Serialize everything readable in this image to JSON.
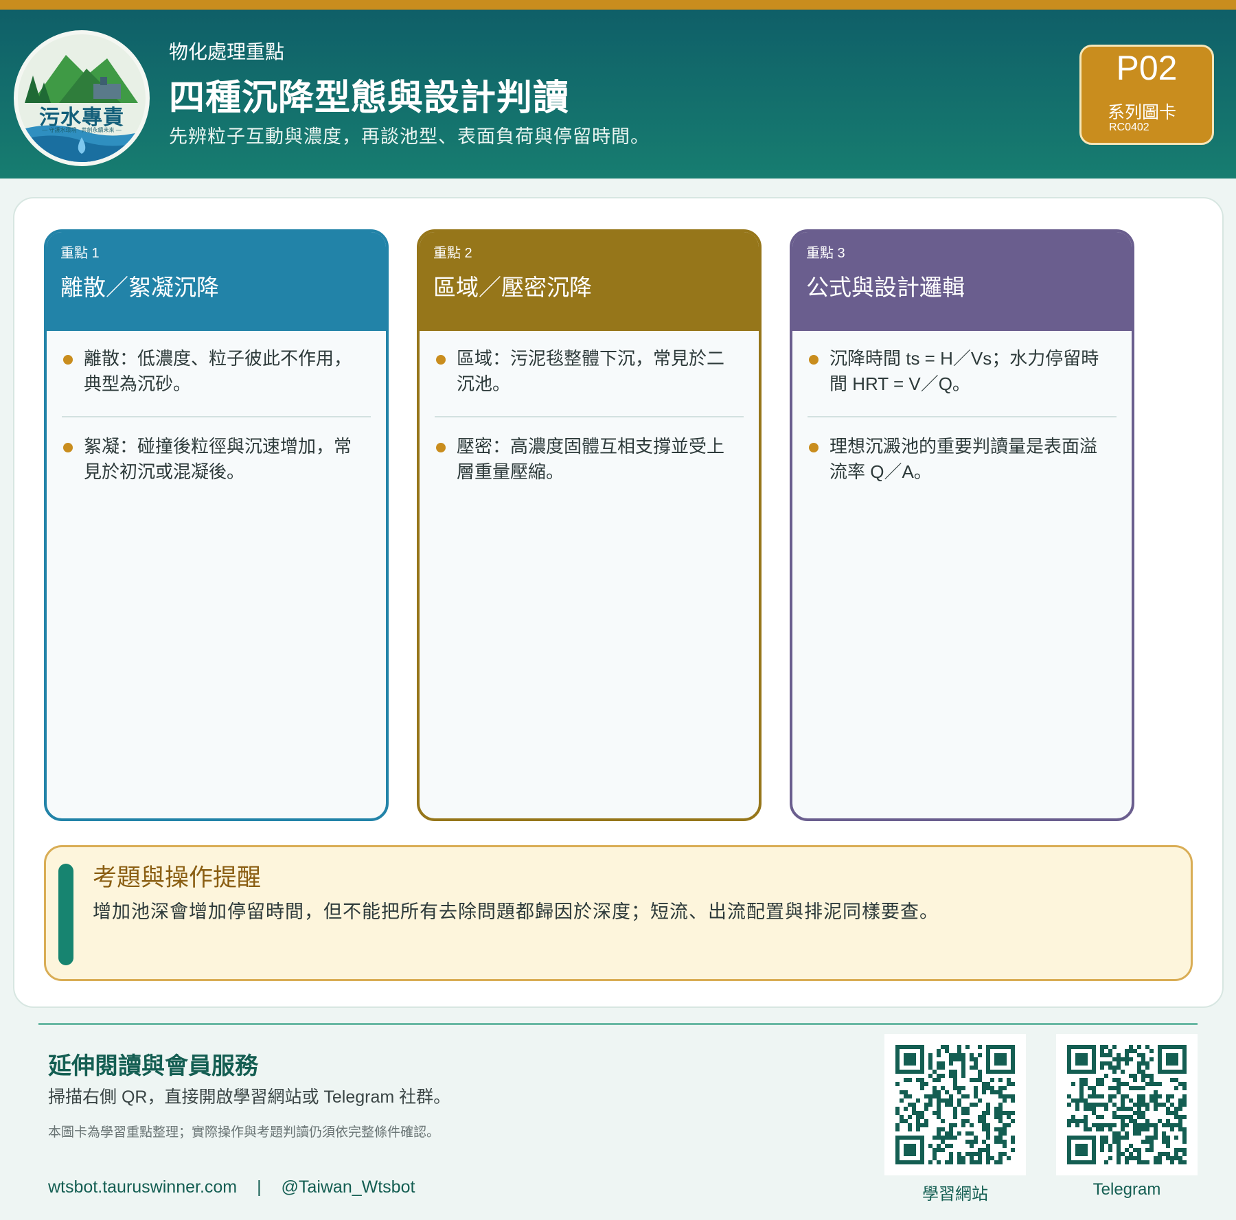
{
  "header": {
    "kicker": "物化處理重點",
    "title": "四種沉降型態與設計判讀",
    "subtitle": "先辨粒子互動與濃度，再談池型、表面負荷與停留時間。",
    "logo_text": "污水專責",
    "logo_sub": "— 守護水環境 · 共創永續未來 —"
  },
  "badge": {
    "code": "P02",
    "label": "系列圖卡",
    "id": "RC0402"
  },
  "cards": [
    {
      "num": "重點 1",
      "title": "離散／絮凝沉降",
      "points": [
        "離散：低濃度、粒子彼此不作用，典型為沉砂。",
        "絮凝：碰撞後粒徑與沉速增加，常見於初沉或混凝後。"
      ]
    },
    {
      "num": "重點 2",
      "title": "區域／壓密沉降",
      "points": [
        "區域：污泥毯整體下沉，常見於二沉池。",
        "壓密：高濃度固體互相支撐並受上層重量壓縮。"
      ]
    },
    {
      "num": "重點 3",
      "title": "公式與設計邏輯",
      "points": [
        "沉降時間 ts = H／Vs；水力停留時間 HRT = V／Q。",
        "理想沉澱池的重要判讀量是表面溢流率 Q／A。"
      ]
    }
  ],
  "reminder": {
    "title": "考題與操作提醒",
    "body": "增加池深會增加停留時間，但不能把所有去除問題都歸因於深度；短流、出流配置與排泥同樣要查。"
  },
  "footer": {
    "title": "延伸閱讀與會員服務",
    "desc": "掃描右側 QR，直接開啟學習網站或 Telegram 社群。",
    "note": "本圖卡為學習重點整理；實際操作與考題判讀仍須依完整條件確認。",
    "website": "wtsbot.tauruswinner.com",
    "separator": "|",
    "telegram_handle": "@Taiwan_Wtsbot",
    "qr_labels": [
      "學習網站",
      "Telegram"
    ]
  },
  "colors": {
    "accent": "#c98d1e",
    "header": "#0f5f68",
    "card1": "#2283a8",
    "card2": "#96761a",
    "card3": "#6a5e8e",
    "reminder_bar": "#178470"
  }
}
